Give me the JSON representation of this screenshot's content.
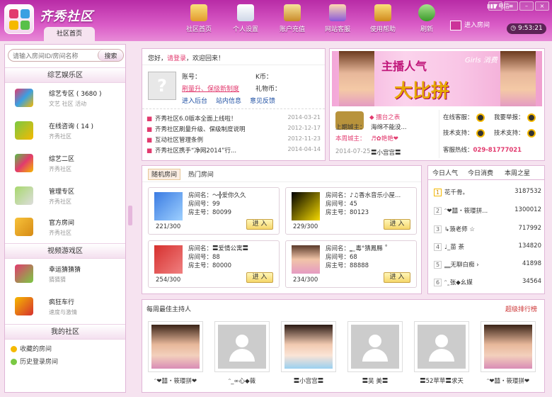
{
  "app": {
    "title": "齐秀社区",
    "home_tab": "社区首页"
  },
  "nav": [
    {
      "label": "社区首页",
      "icon": "house-icon"
    },
    {
      "label": "个人设置",
      "icon": "settings-icon"
    },
    {
      "label": "账户充值",
      "icon": "wallet-icon"
    },
    {
      "label": "网站客服",
      "icon": "support-icon"
    },
    {
      "label": "使用帮助",
      "icon": "help-book-icon"
    },
    {
      "label": "刷新",
      "icon": "refresh-icon"
    }
  ],
  "enter_room": "进入房间",
  "status": "电信",
  "clock": "9:53:21",
  "colors": {
    "header": "#c83bb3",
    "accent": "#e23a6e",
    "link": "#1e4fa3"
  },
  "search": {
    "placeholder": "请输入房间ID/房间名称",
    "value": "请输入房间ID/房间名称",
    "button": "搜索"
  },
  "sidebar": {
    "sections": [
      "综艺娱乐区",
      "视频游戏区",
      "我的社区"
    ],
    "entertainment": [
      {
        "title": "综艺专区 ( 3680 )",
        "sub": "文艺  社区  活动",
        "icon": "variety-icon"
      },
      {
        "title": "在线咨询 ( 14 )",
        "sub": "齐秀社区",
        "icon": "consult-icon"
      },
      {
        "title": "综艺二区",
        "sub": "齐秀社区",
        "icon": "variety2-icon"
      },
      {
        "title": "管理专区",
        "sub": "齐秀社区",
        "icon": "admin-icon"
      },
      {
        "title": "官方房间",
        "sub": "齐秀社区",
        "icon": "official-icon"
      }
    ],
    "games": [
      {
        "title": "幸运猜猜猜",
        "sub": "猜猜猜",
        "icon": "lucky-guess-icon"
      },
      {
        "title": "疯狂车行",
        "sub": "速度与激情",
        "icon": "race-car-icon"
      }
    ],
    "mine": [
      {
        "label": "收藏的房间",
        "icon": "star-icon"
      },
      {
        "label": "历史登录房间",
        "icon": "history-icon"
      }
    ]
  },
  "welcome": {
    "greeting": "您好，",
    "login": "请登录",
    "greeting_end": "，欢迎回来！",
    "account_label": "账号：",
    "kcoin_label": "K币：",
    "gift_label": "礼物币：",
    "link_upgrade": "刷量升、保级新制度",
    "link_backend": "进入后台",
    "link_messages": "站内信息",
    "link_feedback": "意见反馈"
  },
  "news": [
    {
      "text": "齐秀社区6.0版本全面上线啦！",
      "date": "2014-03-21"
    },
    {
      "text": "齐秀社区刷量升级、保级制度说明",
      "date": "2012-12-17"
    },
    {
      "text": "互动社区管理条例",
      "date": "2012-11-23"
    },
    {
      "text": "齐秀社区携手“净网2014”行...",
      "date": "2014-04-14"
    }
  ],
  "banner": {
    "line1": "主播人气",
    "girls": "Girls",
    "consume": "消费",
    "line2": "大比拼",
    "week_king_title": "本周城主：",
    "week_king": "♬✿艳艳❤",
    "king_label": "擂台之表",
    "last_king_title": "上期城主：",
    "last_king": "海绵不能没...",
    "date": "2014-07-25",
    "last_king2": "〓小宫宫〓",
    "online_service": "在线客服：",
    "report": "我要举报：",
    "tech1": "技术支持：",
    "tech2": "技术支持：",
    "hotline_label": "客服热线：",
    "hotline": "029-81777021"
  },
  "room_tabs": [
    "随机房间",
    "热门房间"
  ],
  "rooms": [
    {
      "name": "房间名：～╬爱你久久",
      "num": "房间号：99",
      "owner": "房主号：80099",
      "count": "221/300",
      "btn": "进 入"
    },
    {
      "name": "房间名：♪♫香水音乐小屋...",
      "num": "房间号：45",
      "owner": "房主号：80123",
      "count": "229/300",
      "btn": "进 入"
    },
    {
      "name": "房间名：〓爱情公寓〓",
      "num": "房间号：88",
      "owner": "房主号：80000",
      "count": "254/300",
      "btn": "进 入"
    },
    {
      "name": "房间名：‗˷毒°猜鳳縣 ˚",
      "num": "房间号：68",
      "owner": "房主号：88888",
      "count": "234/300",
      "btn": "进 入"
    }
  ],
  "rank": {
    "tabs": [
      "今日人气",
      "今日消费",
      "本周之星"
    ],
    "rows": [
      {
        "n": "1",
        "name": "花千骨。",
        "value": "3187532"
      },
      {
        "n": "2",
        "name": "ᵔ❤囍・筱璎拼...",
        "value": "1300012"
      },
      {
        "n": "3",
        "name": "↳蒗老师 ☆",
        "value": "717992"
      },
      {
        "n": "4",
        "name": "♩_苗 荼",
        "value": "134820"
      },
      {
        "n": "5",
        "name": "‗‗无聊白痴 ›",
        "value": "41898"
      },
      {
        "n": "6",
        "name": "ᵔ˷张◆幺媒",
        "value": "34564"
      }
    ]
  },
  "weekly": {
    "title": "每周最佳主持人",
    "more": "超级排行榜",
    "hosts": [
      {
        "name": "ᵔ❤囍・筱璎拼❤"
      },
      {
        "name": "ᵔ_∞心◆薇"
      },
      {
        "name": "〓小宫宫〓"
      },
      {
        "name": "〓吴 美〓"
      },
      {
        "name": "〓52苹苹〓求天"
      },
      {
        "name": "ᵔ❤囍・筱璎拼❤"
      }
    ]
  }
}
